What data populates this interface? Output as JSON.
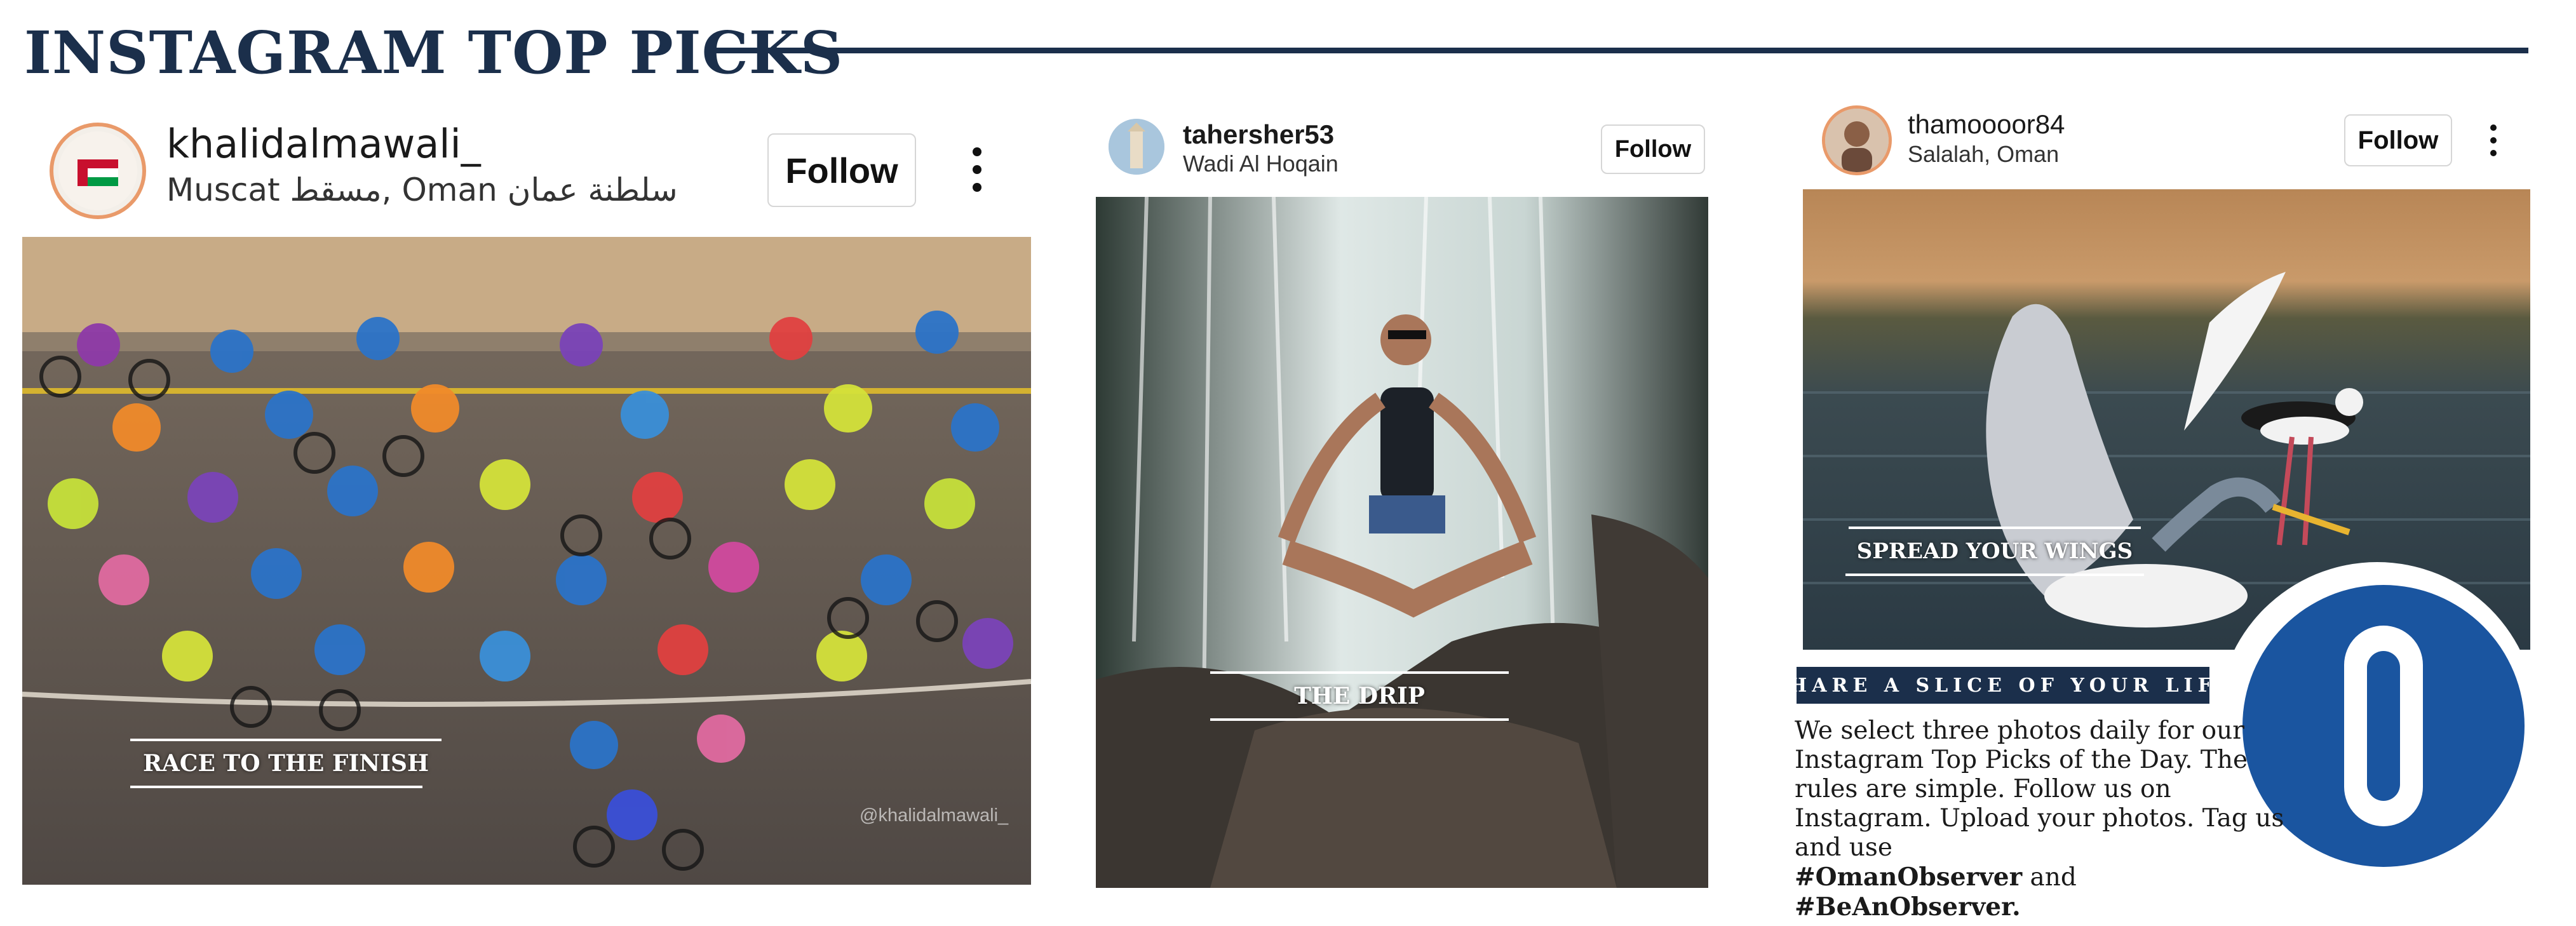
{
  "header": {
    "title": "INSTAGRAM TOP PICKS"
  },
  "posts": [
    {
      "username": "khalidalmawali_",
      "location": "Muscat مسقط, Oman سلطنة عمان",
      "follow_label": "Follow",
      "caption": "RACE TO THE FINISH",
      "watermark": "@khalidalmawali_"
    },
    {
      "username": "tahersher53",
      "location": "Wadi Al Hoqain",
      "follow_label": "Follow",
      "caption": "THE DRIP"
    },
    {
      "username": "thamoooor84",
      "location": "Salalah, Oman",
      "follow_label": "Follow",
      "caption": "SPREAD YOUR WINGS"
    }
  ],
  "info": {
    "banner": "SHARE A SLICE OF YOUR LIFE",
    "body": "We select three photos daily for our Instagram Top Picks of the Day. The rules are simple. Follow us on Instagram. Upload your photos. Tag us and use",
    "hashtag1": "#OmanObserver",
    "joiner": "and",
    "hashtag2": "#BeAnObserver."
  },
  "logo": {
    "letter": "O",
    "color": "#1a55a0"
  },
  "colors": {
    "navy": "#1b2f4b",
    "logo_blue": "#1a55a0"
  }
}
